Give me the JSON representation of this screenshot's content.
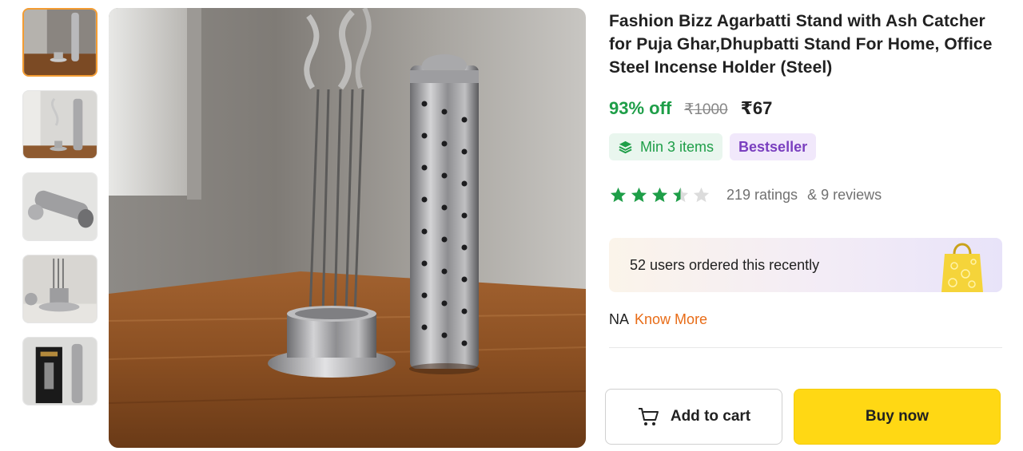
{
  "product": {
    "title": "Fashion Bizz Agarbatti Stand with Ash Catcher for Puja Ghar,Dhupbatti Stand For Home, Office Steel Incense Holder (Steel)",
    "discount": "93% off",
    "mrp": "₹1000",
    "price": "₹67"
  },
  "badges": {
    "min_items": "Min 3 items",
    "bestseller": "Bestseller",
    "min_items_icon": "layers-icon"
  },
  "rating": {
    "stars": 3.5,
    "max_stars": 5,
    "ratings_text": "219 ratings",
    "reviews_text": "& 9 reviews",
    "star_color": "#1e9e48"
  },
  "recent": {
    "text": "52 users ordered this recently",
    "icon": "shopping-bag-icon"
  },
  "delivery": {
    "na": "NA",
    "know_more": "Know More"
  },
  "actions": {
    "add_to_cart": "Add to cart",
    "buy_now": "Buy now",
    "cart_icon": "cart-icon"
  },
  "gallery": {
    "thumbnail_count": 5,
    "active_index": 0
  },
  "colors": {
    "discount_green": "#1e9e48",
    "buy_now_yellow": "#ffd814",
    "know_more_orange": "#e86c17",
    "bestseller_purple": "#7a3fbf",
    "active_thumb_border": "#f39c32"
  }
}
